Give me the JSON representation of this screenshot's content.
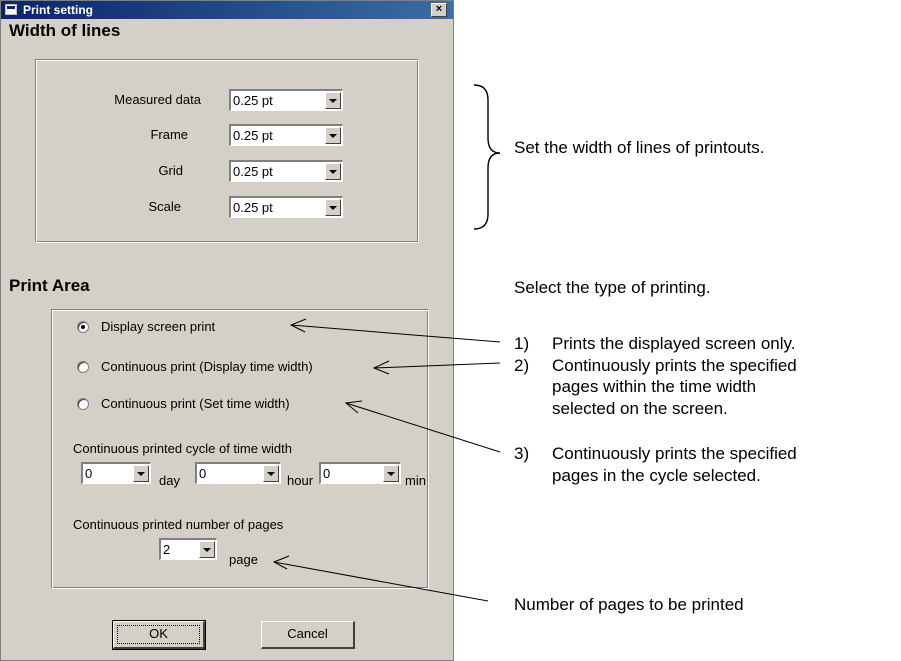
{
  "dialog": {
    "title": "Print setting",
    "close_label": "×",
    "width_section": {
      "heading": "Width of lines",
      "rows": [
        {
          "label": "Measured data",
          "value": "0.25 pt"
        },
        {
          "label": "Frame",
          "value": "0.25 pt"
        },
        {
          "label": "Grid",
          "value": "0.25  pt"
        },
        {
          "label": "Scale",
          "value": "0.25  pt"
        }
      ]
    },
    "area_section": {
      "heading": "Print Area",
      "options": [
        {
          "label": "Display screen print",
          "checked": true
        },
        {
          "label": "Continuous print (Display time width)",
          "checked": false
        },
        {
          "label": "Continuous print (Set time width)",
          "checked": false
        }
      ],
      "cycle_label": "Continuous printed cycle of time width",
      "day_value": "0",
      "day_unit": "day",
      "hour_value": "0",
      "hour_unit": "hour",
      "min_value": "0",
      "min_unit": "min",
      "pages_label": "Continuous printed number of pages",
      "pages_value": "2",
      "pages_unit": "page"
    },
    "ok_label": "OK",
    "cancel_label": "Cancel"
  },
  "annotations": {
    "width_note": "Set the width of lines of printouts.",
    "select_note": "Select the type of printing.",
    "items": [
      {
        "num": "1)",
        "lines": [
          "Prints the displayed screen only."
        ]
      },
      {
        "num": "2)",
        "lines": [
          "Continuously prints the specified",
          "pages within the time width",
          "selected on the screen."
        ]
      },
      {
        "num": "3)",
        "lines": [
          "Continuously prints the specified",
          "pages in the cycle selected."
        ]
      }
    ],
    "pages_note": "Number of pages to be printed"
  }
}
